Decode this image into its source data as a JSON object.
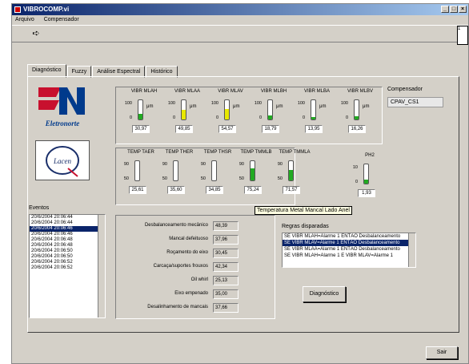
{
  "window": {
    "title": "VIBROCOMP.vi",
    "min_btn": "_",
    "max_btn": "□",
    "close_btn": "×"
  },
  "menu": {
    "items": [
      "Arquivo",
      "Compensador"
    ]
  },
  "toolbar": {
    "run_glyph": "➪",
    "corner_label": "1"
  },
  "tabs": [
    {
      "label": "Diagnóstico",
      "active": true
    },
    {
      "label": "Fuzzy",
      "active": false
    },
    {
      "label": "Análise Espectral",
      "active": false
    },
    {
      "label": "Histórico",
      "active": false
    }
  ],
  "logos": {
    "eletronorte_text": "Eletronorte",
    "lacen_text": "Lacen"
  },
  "vibration": {
    "unit": "μm",
    "scale_top": "100",
    "scale_mid": "50",
    "scale_bottom": "0",
    "meters": [
      {
        "label": "VIBR MLAH",
        "value": "30,97",
        "level": 0.31,
        "color": "#22aa22"
      },
      {
        "label": "VIBR MLAA",
        "value": "49,85",
        "level": 0.5,
        "color": "#e8e800"
      },
      {
        "label": "VIBR MLAV",
        "value": "54,57",
        "level": 0.55,
        "color": "#e8e800"
      },
      {
        "label": "VIBR MLBH",
        "value": "18,79",
        "level": 0.19,
        "color": "#22aa22"
      },
      {
        "label": "VIBR MLBA",
        "value": "13,95",
        "level": 0.14,
        "color": "#22aa22"
      },
      {
        "label": "VIBR MLBV",
        "value": "16,26",
        "level": 0.16,
        "color": "#22aa22"
      }
    ]
  },
  "temperature": {
    "scale_top": "90",
    "scale_bottom": "50",
    "meters": [
      {
        "label": "TEMP TAER",
        "value": "25,61",
        "level": 0.0,
        "color": "#22aa22"
      },
      {
        "label": "TEMP THER",
        "value": "35,60",
        "level": 0.0,
        "color": "#22aa22"
      },
      {
        "label": "TEMP THSR",
        "value": "34,85",
        "level": 0.0,
        "color": "#22aa22"
      },
      {
        "label": "TEMP TMMLB",
        "value": "75,24",
        "level": 0.63,
        "color": "#22aa22"
      },
      {
        "label": "TEMP TMMLA",
        "value": "71,57",
        "level": 0.54,
        "color": "#22aa22"
      }
    ]
  },
  "ph2": {
    "label": "PH2",
    "scale_top": "10",
    "scale_bottom": "0",
    "value": "1,93",
    "level": 0.19,
    "color": "#22aa22"
  },
  "compensador": {
    "label": "Compensador",
    "value": "CPAV_CS1"
  },
  "tooltip": "Temperatura Metal Mancal Lado Anel",
  "events": {
    "label": "Eventos",
    "items": [
      "20/6/2004 20:06:44",
      "20/6/2004 20:06:44",
      "20/6/2004 20:06:46",
      "20/6/2004 20:06:46",
      "20/6/2004 20:06:48",
      "20/6/2004 20:06:48",
      "20/6/2004 20:06:50",
      "20/6/2004 20:06:50",
      "20/6/2004 20:06:52",
      "20/6/2004 20:06:52"
    ],
    "selected_index": 2
  },
  "diagnosis": [
    {
      "label": "Desbalanceamento mecânico",
      "value": "48,39"
    },
    {
      "label": "Mancal defeituoso",
      "value": "37,96"
    },
    {
      "label": "Roçamento do eixo",
      "value": "30,45"
    },
    {
      "label": "Carcaça/suportes frouxos",
      "value": "42,34"
    },
    {
      "label": "Oil whirl",
      "value": "25,13"
    },
    {
      "label": "Eixo empenado",
      "value": "35,00"
    },
    {
      "label": "Desalinhamento de mancais",
      "value": "37,66"
    }
  ],
  "rules": {
    "label": "Regras disparadas",
    "items": [
      "SE VIBR MLAH=Alarme 1 ENTÃO Desbalanceamento",
      "SE VIBR MLAV=Alarme 1 ENTÃO Desbalanceamento",
      "SE VIBR MLAA=Alarme 1 ENTÃO Desbalanceamento",
      "SE VIBR MLAH=Alarme 1 E VIBR MLAV=Alarme 1"
    ],
    "selected_index": 1
  },
  "buttons": {
    "diagnostico": "Diagnóstico",
    "sair": "Sair"
  }
}
